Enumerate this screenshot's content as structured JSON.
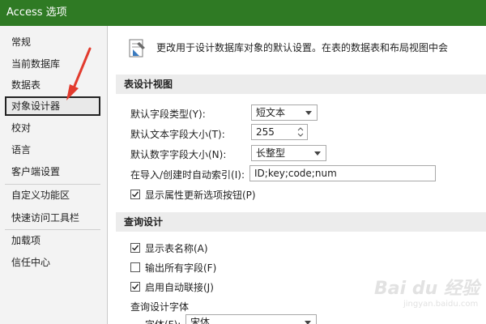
{
  "window": {
    "title": "Access 选项",
    "titlebar_color": "#2f7a24"
  },
  "sidebar": {
    "items": [
      {
        "label": "常规"
      },
      {
        "label": "当前数据库"
      },
      {
        "label": "数据表"
      },
      {
        "label": "对象设计器",
        "selected": true
      },
      {
        "label": "校对"
      },
      {
        "label": "语言"
      },
      {
        "label": "客户端设置"
      },
      {
        "label": "自定义功能区"
      },
      {
        "label": "快速访问工具栏"
      },
      {
        "label": "加载项"
      },
      {
        "label": "信任中心"
      }
    ]
  },
  "main": {
    "header_text": "更改用于设计数据库对象的默认设置。在表的数据表和布局视图中会",
    "table_design": {
      "title": "表设计视图",
      "field_type": {
        "label": "默认字段类型(Y):",
        "value": "短文本"
      },
      "text_size": {
        "label": "默认文本字段大小(T):",
        "value": "255"
      },
      "number_size": {
        "label": "默认数字字段大小(N):",
        "value": "长整型"
      },
      "autoindex": {
        "label": "在导入/创建时自动索引(I):",
        "value": "ID;key;code;num"
      },
      "show_update": {
        "label": "显示属性更新选项按钮(P)",
        "checked": true
      }
    },
    "query_design": {
      "title": "查询设计",
      "show_table_names": {
        "label": "显示表名称(A)",
        "checked": true
      },
      "output_all_fields": {
        "label": "输出所有字段(F)",
        "checked": false
      },
      "auto_join": {
        "label": "启用自动联接(J)",
        "checked": true
      },
      "font_group_label": "查询设计字体",
      "font_label": "字体(F):",
      "font_value": "宋体"
    }
  },
  "annotation": {
    "arrow_color": "#e23b2e"
  },
  "watermark": {
    "main": "Bai du 经验",
    "sub": "jingyan.baidu.com"
  }
}
